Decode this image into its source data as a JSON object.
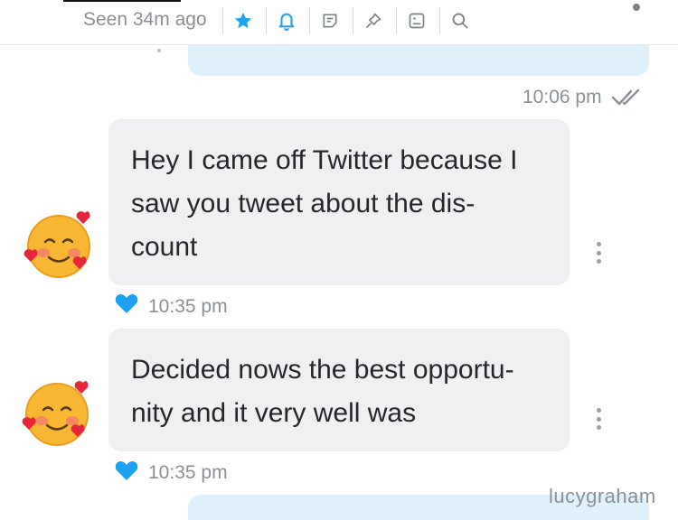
{
  "header": {
    "seen_status": "Seen 34m ago",
    "icons": [
      "star-icon",
      "bell-icon",
      "note-icon",
      "pin-icon",
      "image-icon",
      "search-icon"
    ],
    "accent_color": "#1da1f2"
  },
  "messages": [
    {
      "direction": "outgoing",
      "time": "10:06 pm",
      "status": "read"
    },
    {
      "direction": "incoming",
      "text": "Hey I came off Twitter because I saw you tweet about the dis-count",
      "lines": [
        "Hey I came off Twitter because I",
        "saw you tweet about the dis-",
        "count"
      ],
      "time": "10:35 pm",
      "liked": true
    },
    {
      "direction": "incoming",
      "text": "Decided nows the best opportu-nity and it very well was",
      "lines": [
        "Decided nows the best opportu-",
        "nity and it very well was"
      ],
      "time": "10:35 pm",
      "liked": true
    }
  ],
  "watermark": "lucygraham",
  "colors": {
    "outgoing_bubble": "#dff1fb",
    "incoming_bubble": "#eff0f2",
    "heart": "#1da1f2",
    "meta_text": "#8a9096"
  }
}
